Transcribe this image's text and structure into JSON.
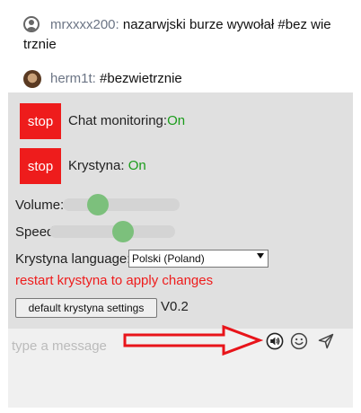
{
  "messages": [
    {
      "username": "mrxxxx200:",
      "text_line1": "nazarwjski burze wywołał #bez wie",
      "text_line2": "trznie",
      "avatar": "user-silhouette-icon"
    },
    {
      "username": "herm1t:",
      "text": "#bezwietrznie",
      "avatar": "user-photo"
    }
  ],
  "panel": {
    "chat_stop_label": "stop",
    "chat_monitoring_label": "Chat monitoring:",
    "chat_monitoring_status": "On",
    "krystyna_stop_label": "stop",
    "krystyna_label": "Krystyna:",
    "krystyna_status": "On",
    "volume_label": "Volume:",
    "volume_level": 0.25,
    "speed_label": "Speed:",
    "speed_level": 0.6,
    "language_label": "Krystyna language:",
    "language_value": "Polski (Poland)",
    "restart_notice": "restart krystyna to apply changes",
    "default_button_label": "default krystyna settings",
    "version": "V0.2"
  },
  "input": {
    "placeholder": "type a message"
  },
  "icons": {
    "speaker": "speaker-icon",
    "emoji": "smiley-icon",
    "send": "send-icon"
  },
  "colors": {
    "stop": "#ee1c1c",
    "on": "#1a9c1a",
    "slider_thumb": "#7cc07c",
    "annotation_arrow": "#e8141a"
  }
}
